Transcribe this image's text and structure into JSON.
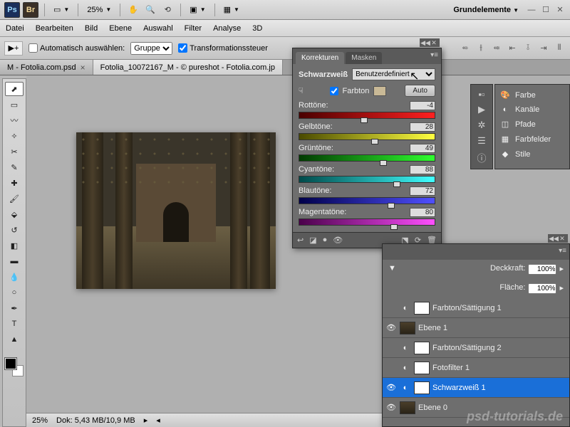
{
  "topbar": {
    "zoom": "25%",
    "workspace": "Grundelemente"
  },
  "menu": {
    "datei": "Datei",
    "bearbeiten": "Bearbeiten",
    "bild": "Bild",
    "ebene": "Ebene",
    "auswahl": "Auswahl",
    "filter": "Filter",
    "analyse": "Analyse",
    "dreid": "3D"
  },
  "optbar": {
    "auto_select": "Automatisch auswählen:",
    "group": "Gruppe",
    "transform": "Transformationssteuer"
  },
  "tabs": {
    "tab1": "M - Fotolia.com.psd",
    "tab2": "Fotolia_10072167_M - © pureshot - Fotolia.com.jp"
  },
  "statusbar": {
    "zoom": "25%",
    "dok": "Dok: 5,43 MB/10,9 MB"
  },
  "korr": {
    "tab1": "Korrekturen",
    "tab2": "Masken",
    "title": "Schwarzweiß",
    "preset": "Benutzerdefiniert",
    "farbton_label": "Farbton",
    "auto": "Auto",
    "sliders": {
      "rot": {
        "label": "Rottöne:",
        "value": "-4"
      },
      "gelb": {
        "label": "Gelbtöne:",
        "value": "28"
      },
      "gruen": {
        "label": "Grüntöne:",
        "value": "49"
      },
      "cyan": {
        "label": "Cyantöne:",
        "value": "88"
      },
      "blau": {
        "label": "Blautöne:",
        "value": "72"
      },
      "magenta": {
        "label": "Magentatöne:",
        "value": "80"
      }
    }
  },
  "dock": {
    "farbe": "Farbe",
    "kanaele": "Kanäle",
    "pfade": "Pfade",
    "farbfelder": "Farbfelder",
    "stile": "Stile"
  },
  "layers": {
    "opacity_label": "Deckkraft:",
    "opacity": "100%",
    "fill_label": "Fläche:",
    "fill": "100%",
    "l1": "Farbton/Sättigung 1",
    "l2": "Ebene 1",
    "l3": "Farbton/Sättigung 2",
    "l4": "Fotofilter 1",
    "l5": "Schwarzweiß 1",
    "l6": "Ebene 0"
  },
  "watermark": "psd-tutorials.de"
}
